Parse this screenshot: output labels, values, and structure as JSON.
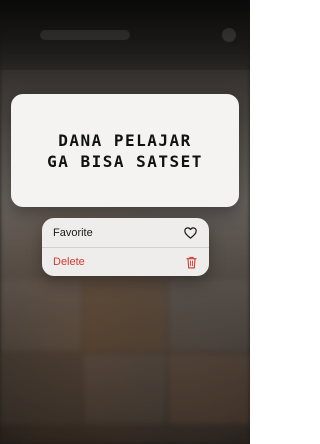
{
  "preview": {
    "line1": "DANA PELAJAR",
    "line2": "GA BISA SATSET"
  },
  "menu": {
    "items": [
      {
        "label": "Favorite",
        "icon": "heart-icon"
      },
      {
        "label": "Delete",
        "icon": "trash-icon",
        "color": "#d33b30"
      }
    ]
  }
}
